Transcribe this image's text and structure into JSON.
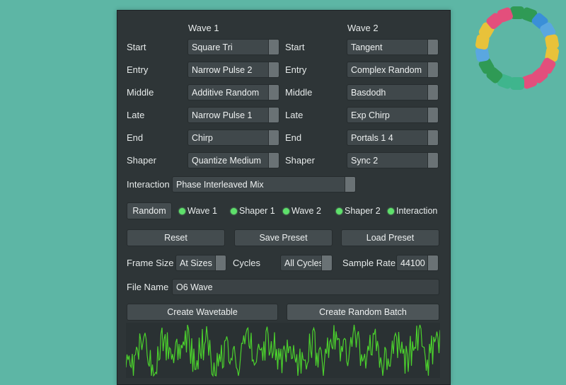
{
  "headers": {
    "wave1": "Wave 1",
    "wave2": "Wave 2"
  },
  "rows": [
    {
      "label": "Start",
      "w1": "Square Tri",
      "w2": "Tangent"
    },
    {
      "label": "Entry",
      "w1": "Narrow Pulse 2",
      "w2": "Complex Random"
    },
    {
      "label": "Middle",
      "w1": "Additive Random",
      "w2": "Basdodh"
    },
    {
      "label": "Late",
      "w1": "Narrow Pulse 1",
      "w2": "Exp Chirp"
    },
    {
      "label": "End",
      "w1": "Chirp",
      "w2": "Portals 1 4"
    },
    {
      "label": "Shaper",
      "w1": "Quantize Medium",
      "w2": "Sync 2"
    }
  ],
  "interaction": {
    "label": "Interaction",
    "value": "Phase Interleaved Mix"
  },
  "random": {
    "button": "Random",
    "toggles": [
      "Wave 1",
      "Shaper 1",
      "Wave 2",
      "Shaper 2",
      "Interaction"
    ],
    "toggle_color": "#5ee06b"
  },
  "actions": {
    "reset": "Reset",
    "save": "Save Preset",
    "load": "Load Preset"
  },
  "settings": {
    "frame_size_label": "Frame Size",
    "frame_size": "At Sizes",
    "cycles_label": "Cycles",
    "cycles": "All Cycles",
    "sample_rate_label": "Sample Rate",
    "sample_rate": "44100"
  },
  "file": {
    "label": "File Name",
    "value": "O6 Wave"
  },
  "create": {
    "wavetable": "Create Wavetable",
    "batch": "Create Random Batch"
  },
  "colors": {
    "background": "#5db6a5",
    "panel": "#2e3537",
    "waveform": "#4bd12d"
  }
}
